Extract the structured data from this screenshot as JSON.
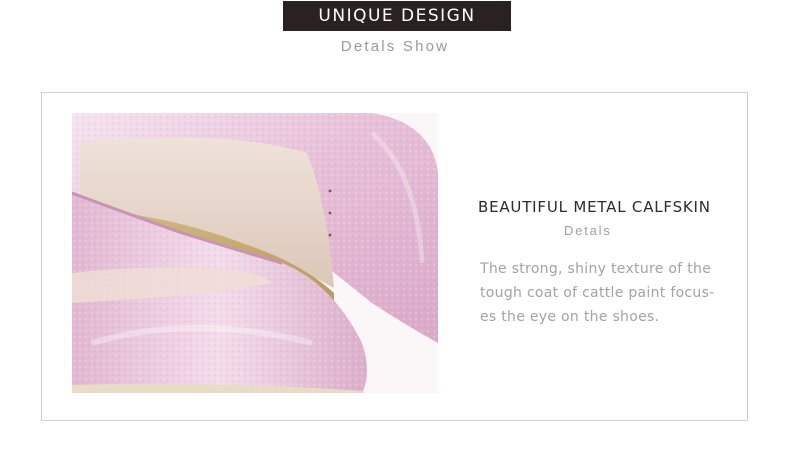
{
  "header": {
    "title": "UNIQUE DESIGN",
    "subtitle": "Detals Show"
  },
  "feature": {
    "title": "BEAUTIFUL METAL CALFSKIN",
    "subtitle": "Detals",
    "description_lines": [
      "The strong, shiny texture of the",
      "tough coat of cattle paint focus-",
      "es the eye on the shoes."
    ]
  },
  "colors": {
    "badge_bg": "#2a2222",
    "shoe_pink": "#e9c6de",
    "insole_tan": "#c5ad74",
    "lining": "#e6d6cc"
  }
}
